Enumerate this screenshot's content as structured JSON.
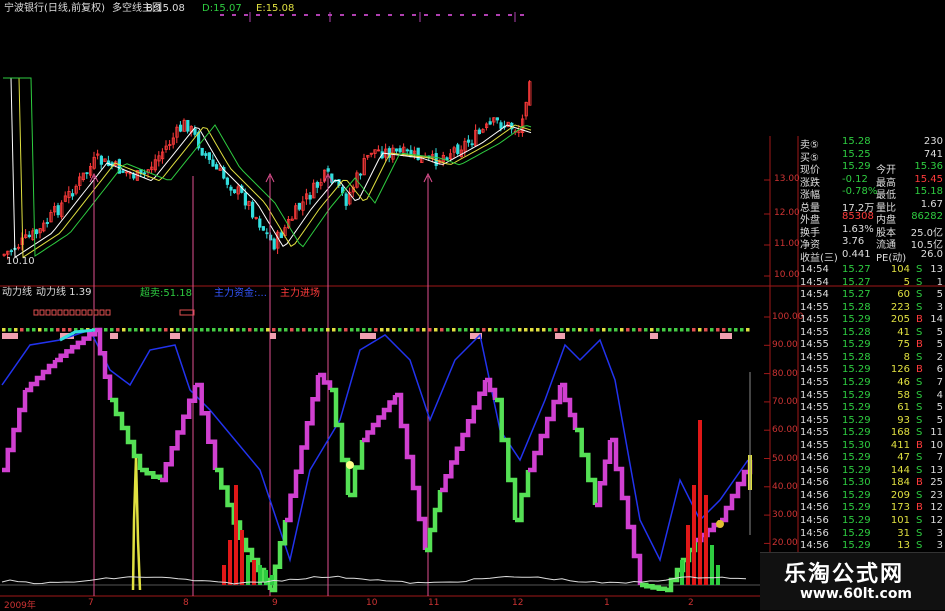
{
  "header": {
    "stock_title": "宁波银行(日线,前复权)",
    "main_chart_name": "多空线主图",
    "b_value": "B:15.08",
    "d_value": "D:15.07",
    "e_value": "E:15.08",
    "top_left_price": "10.10"
  },
  "indicator": {
    "name": "动力线",
    "value_label": "动力线 1.39",
    "overbought_label": "超卖:51.18",
    "blue_label": "主力资金:...",
    "red_label": "主力进场"
  },
  "price_axis": [
    "13.00",
    "12.00",
    "11.00",
    "10.00"
  ],
  "indicator_axis": [
    "100.00",
    "90.00",
    "80.00",
    "70.00",
    "60.00",
    "50.00",
    "40.00",
    "30.00",
    "20.00"
  ],
  "time_axis": [
    "2009年",
    "7",
    "8",
    "9",
    "10",
    "11",
    "12",
    "1",
    "2"
  ],
  "quote_panel": {
    "rows": [
      {
        "label": "卖⑤",
        "v1": "15.28",
        "k2": "",
        "v2": "230",
        "c1": "#2ecc40",
        "c2": "#ddd"
      },
      {
        "label": "买⑤",
        "v1": "15.25",
        "k2": "",
        "v2": "741",
        "c1": "#2ecc40",
        "c2": "#ddd"
      },
      {
        "label": "现价",
        "v1": "15.29",
        "k2": "今开",
        "v2": "15.36",
        "c1": "#2ecc40",
        "c2": "#2ecc40"
      },
      {
        "label": "涨跌",
        "v1": "-0.12",
        "k2": "最高",
        "v2": "15.45",
        "c1": "#2ecc40",
        "c2": "#ff3b3b"
      },
      {
        "label": "涨幅",
        "v1": "-0.78%",
        "k2": "最低",
        "v2": "15.18",
        "c1": "#2ecc40",
        "c2": "#2ecc40"
      },
      {
        "label": "总量",
        "v1": "17.2万",
        "k2": "量比",
        "v2": "1.67",
        "c1": "#ddd",
        "c2": "#ddd"
      },
      {
        "label": "外盘",
        "v1": "85308",
        "k2": "内盘",
        "v2": "86282",
        "c1": "#ff3b3b",
        "c2": "#2ecc40"
      },
      {
        "label": "换手",
        "v1": "1.63%",
        "k2": "股本",
        "v2": "25.0亿",
        "c1": "#ddd",
        "c2": "#ddd"
      },
      {
        "label": "净资",
        "v1": "3.76",
        "k2": "流通",
        "v2": "10.5亿",
        "c1": "#ddd",
        "c2": "#ddd"
      },
      {
        "label": "收益(三)",
        "v1": "0.441",
        "k2": "PE(动)",
        "v2": "26.0",
        "c1": "#ddd",
        "c2": "#ddd"
      }
    ]
  },
  "ticks": [
    {
      "time": "14:54",
      "price": "15.27",
      "vol": "104",
      "bs": "S",
      "n": "13"
    },
    {
      "time": "14:54",
      "price": "15.27",
      "vol": "5",
      "bs": "S",
      "n": "1"
    },
    {
      "time": "14:54",
      "price": "15.27",
      "vol": "60",
      "bs": "S",
      "n": "5"
    },
    {
      "time": "14:55",
      "price": "15.28",
      "vol": "223",
      "bs": "S",
      "n": "3"
    },
    {
      "time": "14:55",
      "price": "15.29",
      "vol": "205",
      "bs": "B",
      "n": "14"
    },
    {
      "time": "14:55",
      "price": "15.28",
      "vol": "41",
      "bs": "S",
      "n": "5"
    },
    {
      "time": "14:55",
      "price": "15.29",
      "vol": "75",
      "bs": "B",
      "n": "5"
    },
    {
      "time": "14:55",
      "price": "15.28",
      "vol": "8",
      "bs": "S",
      "n": "2"
    },
    {
      "time": "14:55",
      "price": "15.29",
      "vol": "126",
      "bs": "B",
      "n": "6"
    },
    {
      "time": "14:55",
      "price": "15.29",
      "vol": "46",
      "bs": "S",
      "n": "7"
    },
    {
      "time": "14:55",
      "price": "15.29",
      "vol": "58",
      "bs": "S",
      "n": "4"
    },
    {
      "time": "14:55",
      "price": "15.29",
      "vol": "61",
      "bs": "S",
      "n": "5"
    },
    {
      "time": "14:55",
      "price": "15.29",
      "vol": "93",
      "bs": "S",
      "n": "5"
    },
    {
      "time": "14:55",
      "price": "15.29",
      "vol": "168",
      "bs": "S",
      "n": "11"
    },
    {
      "time": "14:55",
      "price": "15.30",
      "vol": "411",
      "bs": "B",
      "n": "10"
    },
    {
      "time": "14:56",
      "price": "15.29",
      "vol": "47",
      "bs": "S",
      "n": "7"
    },
    {
      "time": "14:56",
      "price": "15.29",
      "vol": "144",
      "bs": "S",
      "n": "13"
    },
    {
      "time": "14:56",
      "price": "15.30",
      "vol": "184",
      "bs": "B",
      "n": "25"
    },
    {
      "time": "14:56",
      "price": "15.29",
      "vol": "209",
      "bs": "S",
      "n": "23"
    },
    {
      "time": "14:56",
      "price": "15.29",
      "vol": "173",
      "bs": "B",
      "n": "12"
    },
    {
      "time": "14:56",
      "price": "15.29",
      "vol": "101",
      "bs": "S",
      "n": "12"
    },
    {
      "time": "14:56",
      "price": "15.29",
      "vol": "31",
      "bs": "S",
      "n": "3"
    },
    {
      "time": "14:56",
      "price": "15.29",
      "vol": "13",
      "bs": "S",
      "n": "3"
    }
  ],
  "watermark": {
    "title": "乐淘公式网",
    "url": "www.60lt.com"
  },
  "colors": {
    "up": "#ff3b3b",
    "down": "#2ecc40",
    "line_magenta": "#d040d0",
    "line_green": "#55e055",
    "line_blue": "#2233ee",
    "axis_red": "#a01818"
  }
}
